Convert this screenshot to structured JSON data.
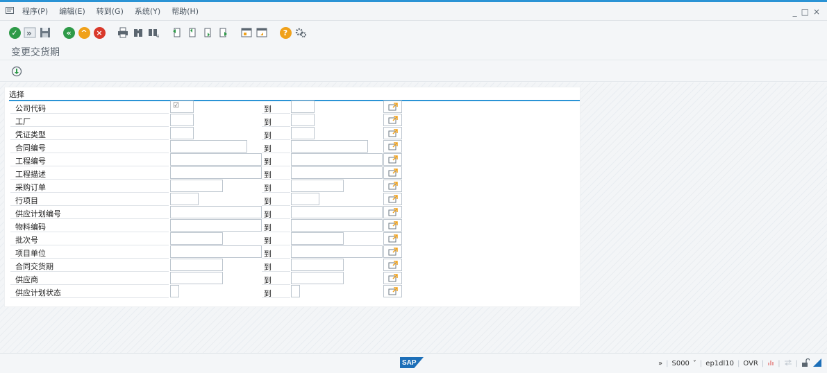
{
  "menu": {
    "items": [
      "程序(P)",
      "编辑(E)",
      "转到(G)",
      "系统(Y)",
      "帮助(H)"
    ]
  },
  "window_controls": {
    "minimize": "_",
    "maximize": "□",
    "close": "×"
  },
  "toolbar": {
    "icons": [
      "enter-icon",
      "command-field-icon",
      "save-icon",
      "back-icon",
      "exit-icon",
      "cancel-icon",
      "print-icon",
      "find-icon",
      "find-next-icon",
      "first-page-icon",
      "previous-page-icon",
      "next-page-icon",
      "last-page-icon",
      "create-session-icon",
      "shortcut-icon",
      "help-icon",
      "customize-icon"
    ],
    "colors": {
      "enter": "#2e9a48",
      "back": "#2e9a48",
      "exit": "#f0a11a",
      "cancel": "#d9392b",
      "help": "#f0a11a"
    }
  },
  "page_title": "变更交货期",
  "selection": {
    "title": "选择",
    "to_label": "到",
    "rows": [
      {
        "label": "公司代码"
      },
      {
        "label": "工厂"
      },
      {
        "label": "凭证类型"
      },
      {
        "label": "合同编号"
      },
      {
        "label": "工程编号"
      },
      {
        "label": "工程描述"
      },
      {
        "label": "采购订单"
      },
      {
        "label": "行项目"
      },
      {
        "label": "供应计划编号"
      },
      {
        "label": "物料编码"
      },
      {
        "label": "批次号"
      },
      {
        "label": "项目单位"
      },
      {
        "label": "合同交货期"
      },
      {
        "label": "供应商"
      },
      {
        "label": "供应计划状态"
      }
    ],
    "company_code_checked": "☑"
  },
  "status": {
    "logo": "SAP",
    "chevron": "»",
    "system": "S000",
    "server": "ep1dl10",
    "mode": "OVR"
  }
}
